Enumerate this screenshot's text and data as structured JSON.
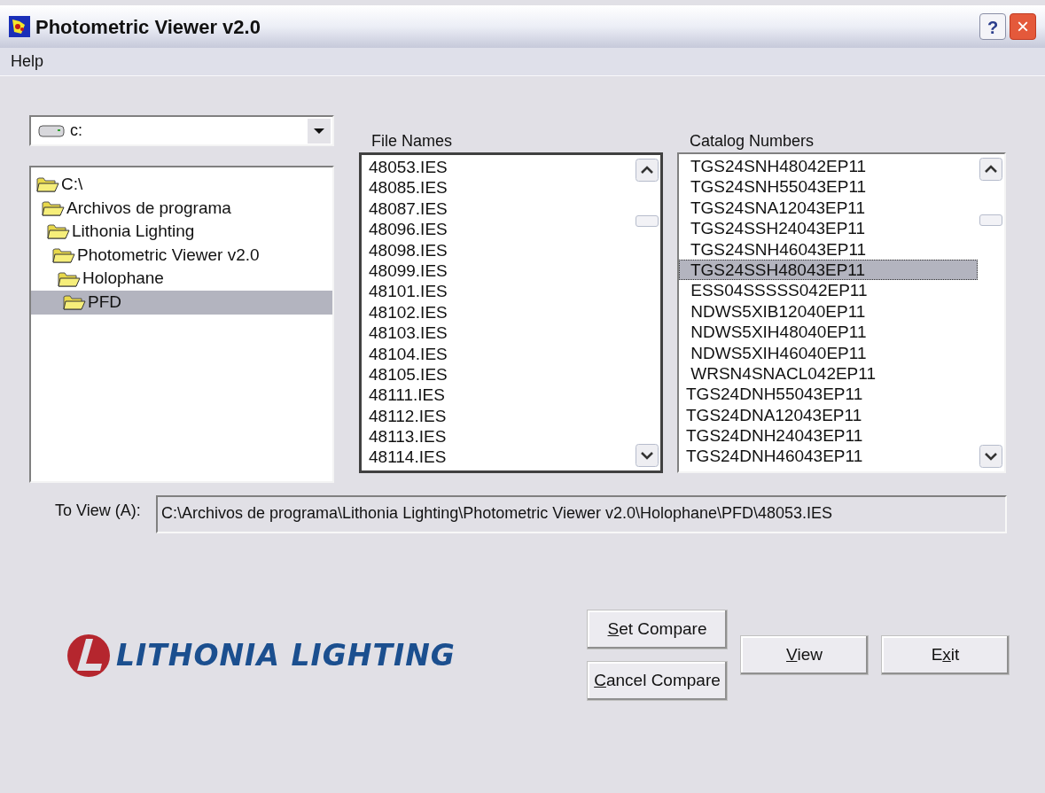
{
  "window": {
    "title": "Photometric Viewer v2.0",
    "help_button": "?",
    "close_button": "×"
  },
  "menu": [
    "Help"
  ],
  "drive": {
    "value": "c:"
  },
  "tree": [
    {
      "label": "C:\\",
      "selected": false,
      "children": [
        {
          "label": "Archivos de programa",
          "selected": false,
          "children": [
            {
              "label": "Lithonia Lighting",
              "selected": false,
              "children": [
                {
                  "label": "Photometric Viewer v2.0",
                  "selected": false,
                  "children": [
                    {
                      "label": "Holophane",
                      "selected": false,
                      "children": [
                        {
                          "label": "PFD",
                          "selected": true
                        }
                      ]
                    }
                  ]
                }
              ]
            }
          ]
        }
      ]
    }
  ],
  "file_names": {
    "heading": "File Names",
    "focused": true,
    "items": [
      {
        "label": "48053.IES",
        "selected": false
      },
      {
        "label": "48085.IES",
        "selected": false
      },
      {
        "label": "48087.IES",
        "selected": false
      },
      {
        "label": "48096.IES",
        "selected": false
      },
      {
        "label": "48098.IES",
        "selected": false
      },
      {
        "label": "48099.IES",
        "selected": false
      },
      {
        "label": "48101.IES",
        "selected": false
      },
      {
        "label": "48102.IES",
        "selected": false
      },
      {
        "label": "48103.IES",
        "selected": false
      },
      {
        "label": "48104.IES",
        "selected": false
      },
      {
        "label": "48105.IES",
        "selected": false
      },
      {
        "label": "48111.IES",
        "selected": false
      },
      {
        "label": "48112.IES",
        "selected": false
      },
      {
        "label": "48113.IES",
        "selected": false
      },
      {
        "label": "48114.IES",
        "selected": false
      }
    ]
  },
  "catalog_numbers": {
    "heading": "Catalog Numbers",
    "focused": false,
    "items": [
      {
        "label": " TGS24SNH48042EP11",
        "selected": false
      },
      {
        "label": " TGS24SNH55043EP11",
        "selected": false
      },
      {
        "label": " TGS24SNA12043EP11",
        "selected": false
      },
      {
        "label": " TGS24SSH24043EP11",
        "selected": false
      },
      {
        "label": " TGS24SNH46043EP11",
        "selected": false
      },
      {
        "label": " TGS24SSH48043EP11",
        "selected": true
      },
      {
        "label": " ESS04SSSSS042EP11",
        "selected": false
      },
      {
        "label": " NDWS5XIB12040EP11",
        "selected": false
      },
      {
        "label": " NDWS5XIH48040EP11",
        "selected": false
      },
      {
        "label": " NDWS5XIH46040EP11",
        "selected": false
      },
      {
        "label": " WRSN4SNACL042EP11",
        "selected": false
      },
      {
        "label": "TGS24DNH55043EP11",
        "selected": false
      },
      {
        "label": "TGS24DNA12043EP11",
        "selected": false
      },
      {
        "label": "TGS24DNH24043EP11",
        "selected": false
      },
      {
        "label": "TGS24DNH46043EP11",
        "selected": false
      }
    ]
  },
  "to_view": {
    "label": "To View (A):",
    "value": "C:\\Archivos de programa\\Lithonia Lighting\\Photometric Viewer v2.0\\Holophane\\PFD\\48053.IES"
  },
  "logo": {
    "text": "LITHONIA LIGHTING"
  },
  "buttons": [
    {
      "kind": "compare",
      "key": "S",
      "post": "et Compare"
    },
    {
      "kind": "compare",
      "key": "C",
      "post": "ancel Compare"
    },
    {
      "kind": "main",
      "key": "V",
      "post": "iew"
    },
    {
      "kind": "main",
      "pre": "E",
      "key": "x",
      "post": "it"
    }
  ]
}
